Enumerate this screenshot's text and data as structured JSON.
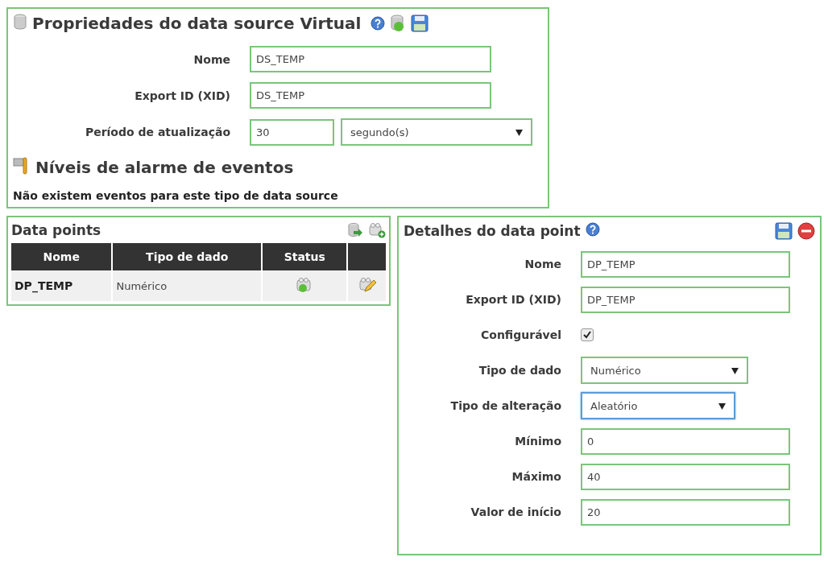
{
  "data_source": {
    "title": "Propriedades do data source Virtual",
    "fields": [
      {
        "kind": "text",
        "label": "Nome",
        "value": "DS_TEMP"
      },
      {
        "kind": "text",
        "label": "Export ID (XID)",
        "value": "DS_TEMP"
      },
      {
        "kind": "period",
        "label": "Período de atualização",
        "value": "30",
        "unit": "segundo(s)"
      }
    ],
    "events_heading": "Níveis de alarme de eventos",
    "events_message": "Não existem eventos para este tipo de data source"
  },
  "data_points": {
    "title": "Data points",
    "columns": [
      "Nome",
      "Tipo de dado",
      "Status"
    ],
    "rows": [
      {
        "name": "DP_TEMP",
        "data_type": "Numérico",
        "enabled": true
      }
    ]
  },
  "point_details": {
    "title": "Detalhes do data point",
    "fields": [
      {
        "kind": "text",
        "label": "Nome",
        "value": "DP_TEMP"
      },
      {
        "kind": "text",
        "label": "Export ID (XID)",
        "value": "DP_TEMP"
      },
      {
        "kind": "checkbox",
        "label": "Configurável",
        "checked": true
      },
      {
        "kind": "select",
        "label": "Tipo de dado",
        "value": "Numérico",
        "focused": false
      },
      {
        "kind": "select",
        "label": "Tipo de alteração",
        "value": "Aleatório",
        "focused": true
      },
      {
        "kind": "text",
        "label": "Mínimo",
        "value": "0"
      },
      {
        "kind": "text",
        "label": "Máximo",
        "value": "40"
      },
      {
        "kind": "text",
        "label": "Valor de início",
        "value": "20"
      }
    ]
  }
}
